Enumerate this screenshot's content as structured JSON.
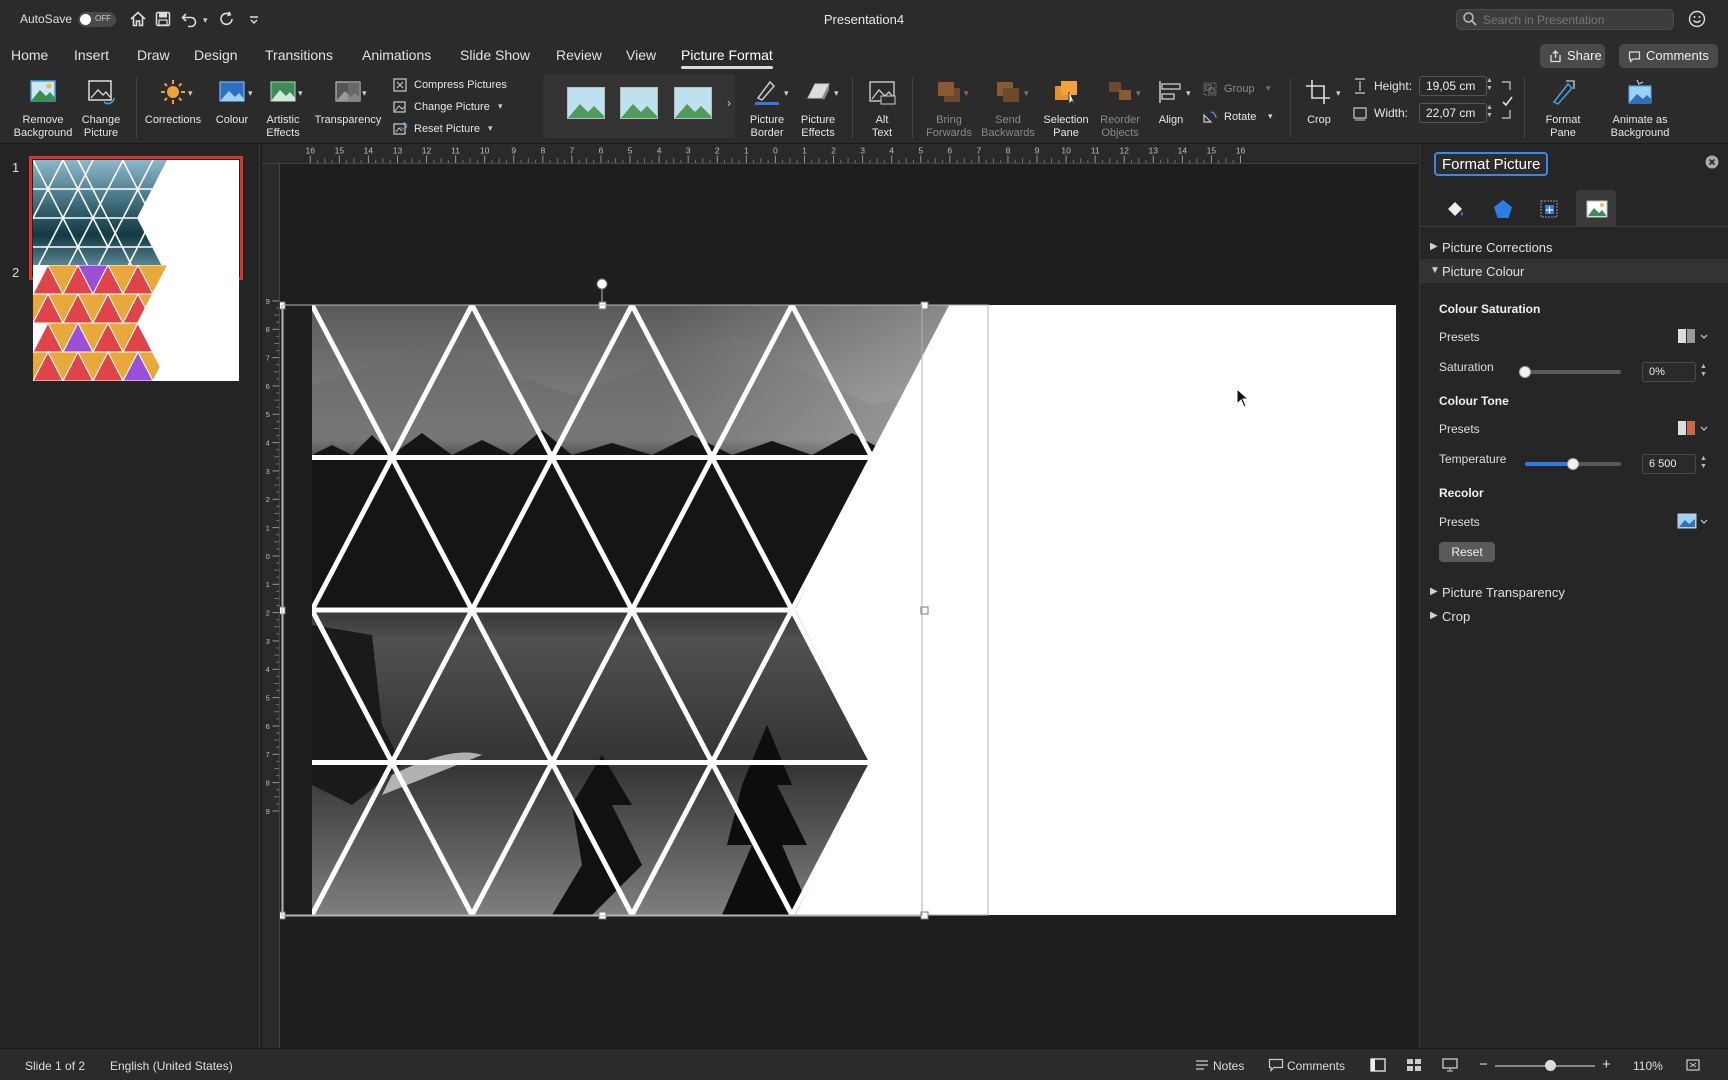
{
  "titlebar": {
    "autosave_label": "AutoSave",
    "autosave_state": "OFF",
    "document_title": "Presentation4",
    "search_placeholder": "Search in Presentation"
  },
  "tabs": {
    "items": [
      "Home",
      "Insert",
      "Draw",
      "Design",
      "Transitions",
      "Animations",
      "Slide Show",
      "Review",
      "View",
      "Picture Format"
    ],
    "active": "Picture Format",
    "share_label": "Share",
    "comments_label": "Comments"
  },
  "ribbon": {
    "remove_background": "Remove\nBackground",
    "change_picture_big": "Change\nPicture",
    "corrections": "Corrections",
    "colour": "Colour",
    "artistic_effects": "Artistic\nEffects",
    "transparency": "Transparency",
    "compress_pictures": "Compress Pictures",
    "change_picture": "Change Picture",
    "reset_picture": "Reset Picture",
    "picture_border": "Picture\nBorder",
    "picture_effects": "Picture\nEffects",
    "alt_text": "Alt\nText",
    "bring_forwards": "Bring\nForwards",
    "send_backwards": "Send\nBackwards",
    "selection_pane": "Selection\nPane",
    "reorder_objects": "Reorder\nObjects",
    "align": "Align",
    "group": "Group",
    "rotate": "Rotate",
    "crop": "Crop",
    "height_label": "Height:",
    "height_value": "19,05 cm",
    "width_label": "Width:",
    "width_value": "22,07 cm",
    "format_pane": "Format\nPane",
    "animate_as_background": "Animate as\nBackground"
  },
  "rulers": {
    "horizontal": [
      "16",
      "15",
      "14",
      "13",
      "12",
      "11",
      "10",
      "9",
      "8",
      "7",
      "6",
      "5",
      "4",
      "3",
      "2",
      "1",
      "0",
      "1",
      "2",
      "3",
      "4",
      "5",
      "6",
      "7",
      "8",
      "9",
      "10",
      "11",
      "12",
      "13",
      "14",
      "15",
      "16"
    ],
    "vertical": [
      "9",
      "8",
      "7",
      "6",
      "5",
      "4",
      "3",
      "2",
      "1",
      "0",
      "1",
      "2",
      "3",
      "4",
      "5",
      "6",
      "7",
      "8",
      "9"
    ]
  },
  "thumbnails": [
    {
      "number": "1",
      "selected": true
    },
    {
      "number": "2",
      "selected": false
    }
  ],
  "pane": {
    "title": "Format Picture",
    "sections": {
      "picture_corrections": "Picture Corrections",
      "picture_colour": "Picture Colour",
      "picture_transparency": "Picture Transparency",
      "crop": "Crop"
    },
    "colour_saturation": "Colour Saturation",
    "presets": "Presets",
    "saturation_label": "Saturation",
    "saturation_value": "0%",
    "saturation_level": 0,
    "colour_tone": "Colour Tone",
    "temperature_label": "Temperature",
    "temperature_value": "6 500",
    "temperature_level": 0.5,
    "recolor": "Recolor",
    "reset": "Reset"
  },
  "statusbar": {
    "slide_info": "Slide 1 of 2",
    "language": "English (United States)",
    "notes": "Notes",
    "comments": "Comments",
    "zoom": "110%",
    "zoom_level": 0.55
  },
  "colors": {
    "accent": "#2f7be6",
    "selection": "#d1372e",
    "triangle_orange": "#e8a93a",
    "triangle_red": "#e0444a",
    "triangle_purple": "#9b4fd6"
  }
}
